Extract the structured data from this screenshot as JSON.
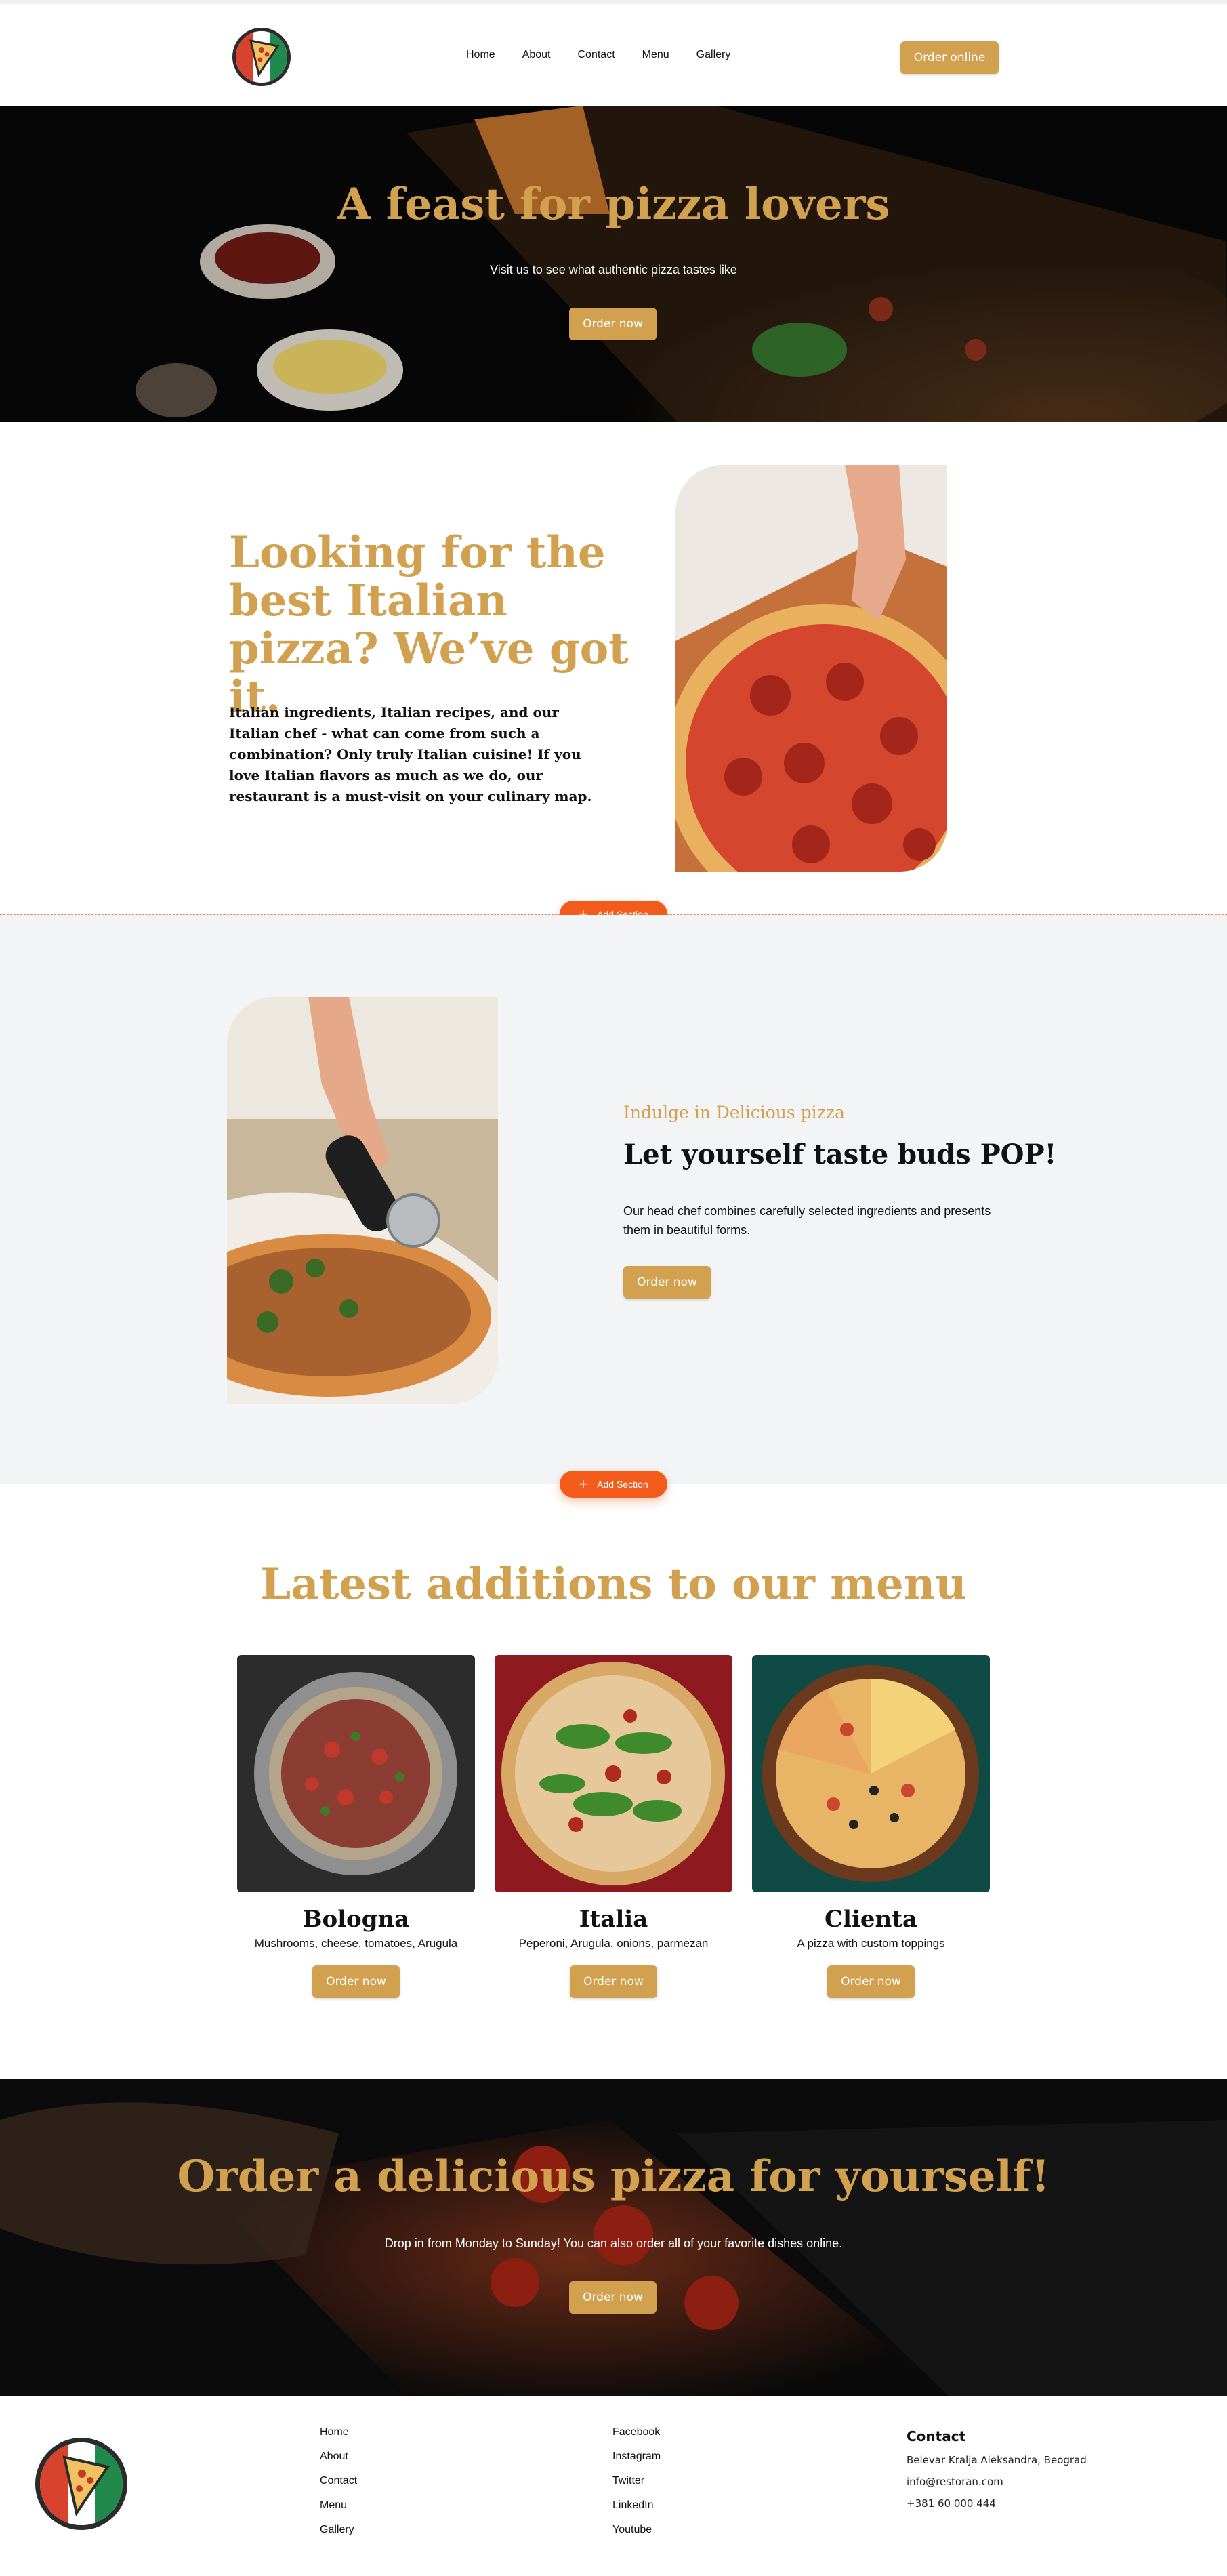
{
  "header": {
    "nav": [
      "Home",
      "About",
      "Contact",
      "Menu",
      "Gallery"
    ],
    "order_label": "Order online"
  },
  "hero": {
    "title": "A feast for pizza lovers",
    "subtitle": "Visit us to see what authentic pizza tastes like",
    "button": "Order now"
  },
  "about": {
    "title": "Looking for the best Italian pizza? We’ve got it.",
    "text": "Italian ingredients, Italian recipes, and our Italian chef - what can come from such a combination? Only truly Italian cuisine! If you love Italian flavors as much as we do, our restaurant is a must-visit on your culinary map."
  },
  "editor": {
    "add_section_label": "Add Section"
  },
  "feature": {
    "kicker": "Indulge in Delicious pizza",
    "title": "Let yourself taste buds POP!",
    "text": "Our head chef combines carefully selected ingredients and presents them in beautiful forms.",
    "button": "Order now"
  },
  "menu": {
    "title": "Latest additions to our menu",
    "items": [
      {
        "name": "Bologna",
        "desc": "Mushrooms, cheese, tomatoes, Arugula",
        "button": "Order now"
      },
      {
        "name": "Italia",
        "desc": "Peperoni, Arugula, onions, parmezan",
        "button": "Order now"
      },
      {
        "name": "Clienta",
        "desc": "A pizza with custom toppings",
        "button": "Order now"
      }
    ]
  },
  "cta": {
    "title": "Order a delicious pizza for yourself!",
    "subtitle": "Drop in from Monday to Sunday! You can also order all of your favorite dishes online.",
    "button": "Order now"
  },
  "footer": {
    "col1": [
      "Home",
      "About",
      "Contact",
      "Menu",
      "Gallery"
    ],
    "col2": [
      "Facebook",
      "Instagram",
      "Twitter",
      "LinkedIn",
      "Youtube"
    ],
    "contact_title": "Contact",
    "address": "Belevar Kralja Aleksandra, Beograd",
    "email": "info@restoran.com",
    "phone": "+381 60 000 444"
  },
  "colors": {
    "gold": "#d1a150",
    "accent": "#f35b1b",
    "section_bg": "#f3f4f6"
  }
}
